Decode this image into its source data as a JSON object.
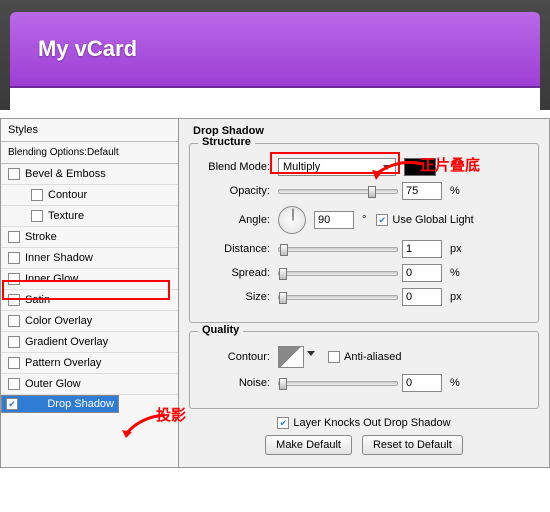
{
  "preview": {
    "title": "My vCard"
  },
  "sidebar": {
    "title": "Styles",
    "subtitle": "Blending Options:Default",
    "items": [
      {
        "label": "Bevel & Emboss",
        "checked": false,
        "indent": false
      },
      {
        "label": "Contour",
        "checked": false,
        "indent": true
      },
      {
        "label": "Texture",
        "checked": false,
        "indent": true
      },
      {
        "label": "Stroke",
        "checked": false,
        "indent": false
      },
      {
        "label": "Inner Shadow",
        "checked": false,
        "indent": false
      },
      {
        "label": "Inner Glow",
        "checked": false,
        "indent": false
      },
      {
        "label": "Satin",
        "checked": false,
        "indent": false
      },
      {
        "label": "Color Overlay",
        "checked": false,
        "indent": false
      },
      {
        "label": "Gradient Overlay",
        "checked": false,
        "indent": false
      },
      {
        "label": "Pattern Overlay",
        "checked": false,
        "indent": false
      },
      {
        "label": "Outer Glow",
        "checked": false,
        "indent": false
      },
      {
        "label": "Drop Shadow",
        "checked": true,
        "indent": false,
        "selected": true
      }
    ]
  },
  "panel": {
    "title": "Drop Shadow",
    "structure": {
      "title": "Structure",
      "blendModeLabel": "Blend Mode:",
      "blendMode": "Multiply",
      "opacityLabel": "Opacity:",
      "opacity": "75",
      "angleLabel": "Angle:",
      "angle": "90",
      "deg": "°",
      "useGlobalLabel": "Use Global Light",
      "useGlobal": true,
      "distanceLabel": "Distance:",
      "distance": "1",
      "spreadLabel": "Spread:",
      "spread": "0",
      "sizeLabel": "Size:",
      "size": "0",
      "pct": "%",
      "px": "px"
    },
    "quality": {
      "title": "Quality",
      "contourLabel": "Contour:",
      "antiAliasedLabel": "Anti-aliased",
      "antiAliased": false,
      "noiseLabel": "Noise:",
      "noise": "0",
      "pct": "%"
    },
    "knocksOutLabel": "Layer Knocks Out Drop Shadow",
    "knocksOut": true,
    "makeDefault": "Make Default",
    "resetDefault": "Reset to Default"
  },
  "annotations": {
    "a1": "投影",
    "a2": "正片叠底"
  }
}
